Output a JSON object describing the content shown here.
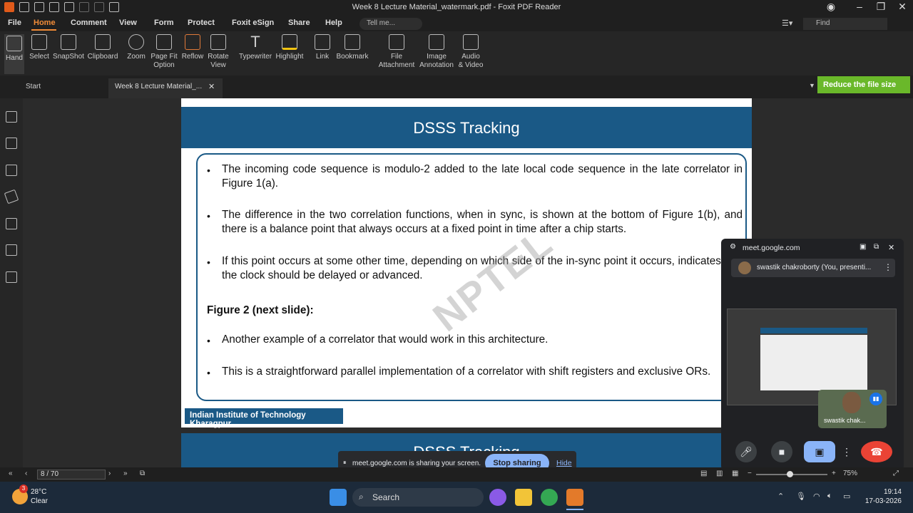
{
  "window": {
    "title": "Week 8 Lecture Material_watermark.pdf - Foxit PDF Reader"
  },
  "menu": [
    "File",
    "Home",
    "Comment",
    "View",
    "Form",
    "Protect",
    "Foxit eSign",
    "Share",
    "Help"
  ],
  "tell_me": "Tell me...",
  "find": "Find",
  "ribbon": [
    {
      "label": "Hand"
    },
    {
      "label": "Select"
    },
    {
      "label": "SnapShot"
    },
    {
      "label": "Clipboard"
    },
    {
      "label": "Zoom"
    },
    {
      "label": "Page Fit\nOption"
    },
    {
      "label": "Reflow"
    },
    {
      "label": "Rotate\nView"
    },
    {
      "label": "Typewriter"
    },
    {
      "label": "Highlight"
    },
    {
      "label": "Link"
    },
    {
      "label": "Bookmark"
    },
    {
      "label": "File\nAttachment"
    },
    {
      "label": "Image\nAnnotation"
    },
    {
      "label": "Audio\n& Video"
    }
  ],
  "tabs": {
    "start": "Start",
    "doc": "Week 8 Lecture Material_..."
  },
  "reduce_banner": "Reduce the file size",
  "slide": {
    "title": "DSSS Tracking",
    "bullets": [
      "The incoming code sequence is modulo-2 added to the late local code sequence in the late correlator in Figure  1(a).",
      "The difference in the two correlation functions, when in sync, is shown at the bottom of Figure 1(b), and there is a balance point that always occurs at a fixed point in time after a chip starts.",
      "If this point occurs at some other time, depending on which side of the in-sync point it occurs, indicates that the clock should be delayed or advanced."
    ],
    "figure_heading": "Figure 2 (next slide):",
    "bullets2": [
      "Another example of a correlator that would work in this architecture.",
      "This is a straightforward parallel implementation of a correlator with shift registers and exclusive ORs."
    ],
    "footer": "Indian Institute of Technology Kharagpur",
    "watermark": "NPTEL",
    "next_title": "DSSS Tracking"
  },
  "meet": {
    "url": "meet.google.com",
    "presenter": "swastik chakroborty (You, presenti...",
    "tile_name": "swastik chak..."
  },
  "sharebar": {
    "message": "meet.google.com is sharing your screen.",
    "stop": "Stop sharing",
    "hide": "Hide"
  },
  "status": {
    "page": "8 / 70",
    "zoom": "75%"
  },
  "taskbar": {
    "search": "Search",
    "temp": "28°C",
    "weather": "Clear",
    "time": "19:14",
    "date": "17-03-2026",
    "badge": "3"
  }
}
